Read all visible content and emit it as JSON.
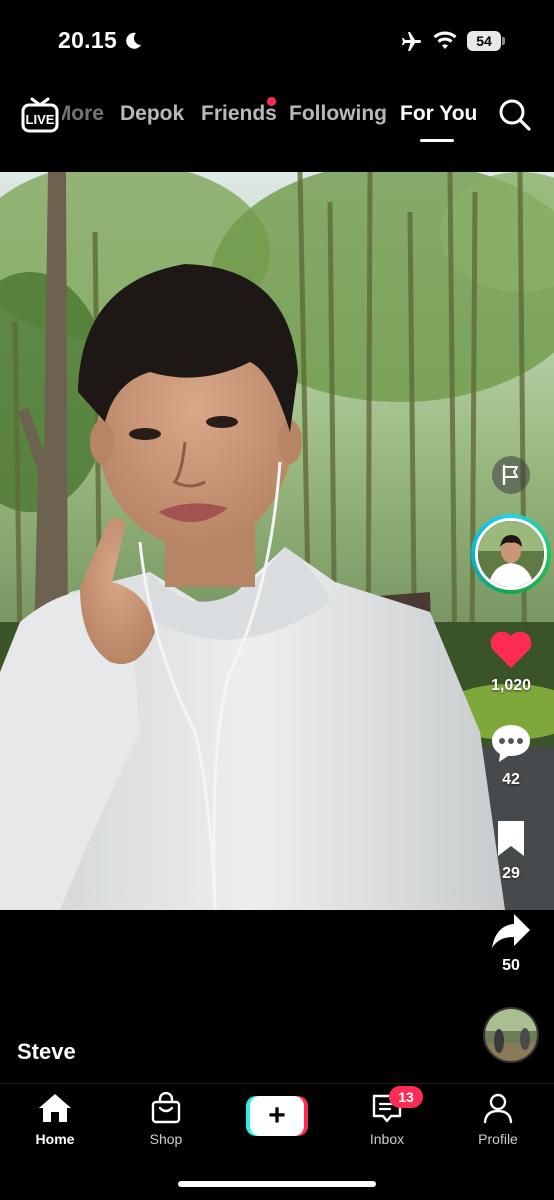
{
  "status_bar": {
    "time": "20.15",
    "battery": "54"
  },
  "top_nav": {
    "live_label": "LIVE",
    "tabs": [
      {
        "label": "More"
      },
      {
        "label": "Depok"
      },
      {
        "label": "Friends"
      },
      {
        "label": "Following"
      },
      {
        "label": "For You"
      }
    ],
    "active_tab": "For You"
  },
  "actions": {
    "likes": "1,020",
    "comments": "42",
    "bookmarks": "29",
    "shares": "50"
  },
  "video": {
    "author": "Steve"
  },
  "bottom_nav": {
    "home": "Home",
    "shop": "Shop",
    "create": "+",
    "inbox": "Inbox",
    "inbox_badge": "13",
    "profile": "Profile"
  },
  "colors": {
    "accent_red": "#fe2c55",
    "accent_cyan": "#25f4ee",
    "background": "#000000"
  }
}
